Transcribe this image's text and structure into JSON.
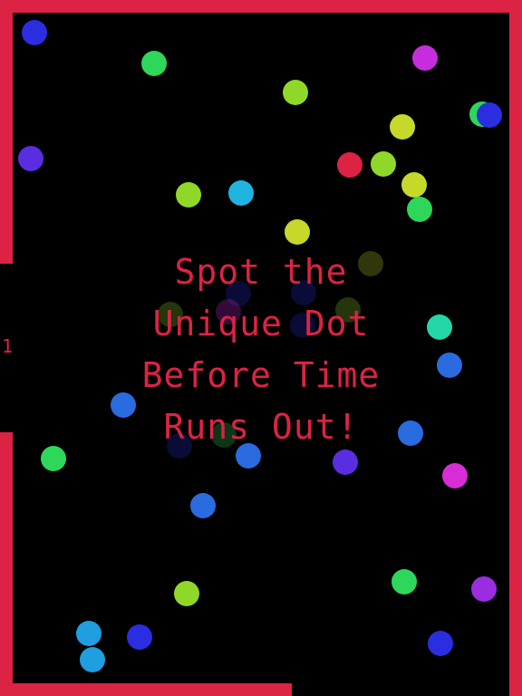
{
  "game": {
    "message_lines": [
      "Spot the",
      "Unique Dot",
      "Before Time",
      "Runs Out!"
    ],
    "level_indicator": "1",
    "border_color": "#dc2344",
    "background_color": "#000000"
  },
  "dot_colors": {
    "blue": "#2b2de0",
    "green": "#2ed65a",
    "magenta": "#c62dde",
    "lime": "#8fd82a",
    "yellow_green": "#c6d82a",
    "violet": "#5a2de0",
    "red": "#dc2344",
    "cyan": "#1fb4e0",
    "teal": "#22d6a8",
    "royal_blue": "#2a6be0",
    "pink": "#d62dd6",
    "purple": "#9a2de0",
    "sky_blue": "#1f9ee0"
  }
}
